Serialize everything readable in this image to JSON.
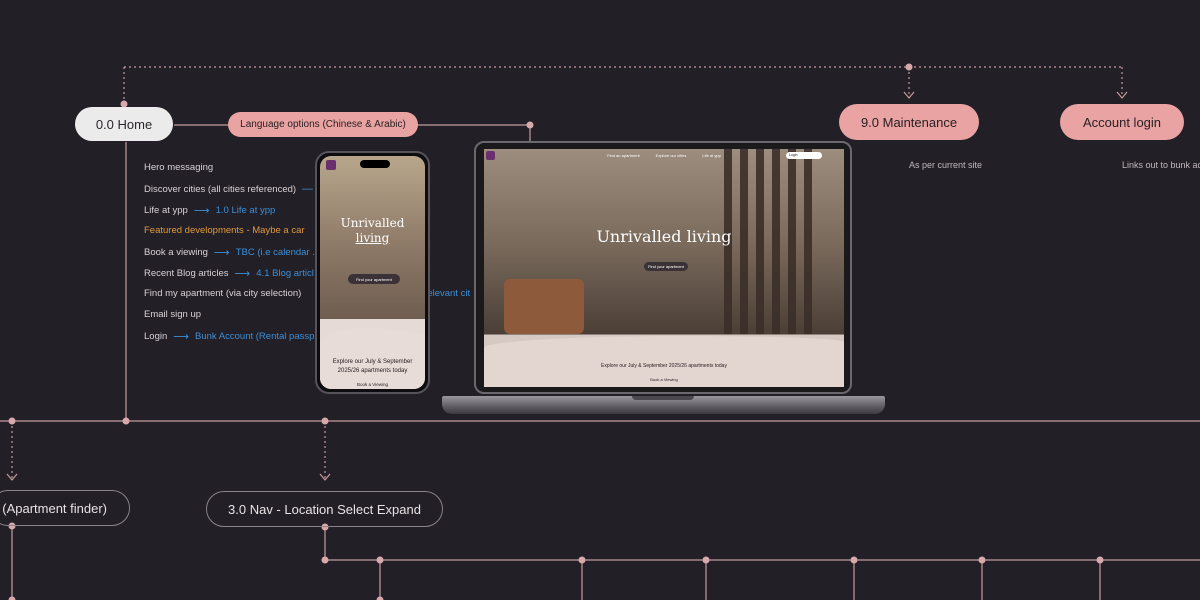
{
  "nodes": {
    "home": "0.0 Home",
    "language": "Language options (Chinese & Arabic)",
    "maintenance": "9.0 Maintenance",
    "account_login": "Account login",
    "apartment_finder": "(Apartment finder)",
    "nav_location": "3.0 Nav - Location Select Expand"
  },
  "notes": {
    "maintenance": "As per current site",
    "account_login": "Links out to bunk ac"
  },
  "home_sections": [
    {
      "label": "Hero messaging",
      "highlight": false,
      "link": ""
    },
    {
      "label": "Discover cities (all cities referenced)",
      "highlight": false,
      "link": ""
    },
    {
      "label": "Life at ypp",
      "highlight": false,
      "link": "1.0 Life at ypp"
    },
    {
      "label": "Featured developments - Maybe a car",
      "highlight": true,
      "link": ""
    },
    {
      "label": "Book a viewing",
      "highlight": false,
      "link": "TBC (i.e calendar ... on)"
    },
    {
      "label": "Recent Blog articles",
      "highlight": false,
      "link": "4.1 Blog articl"
    },
    {
      "label": "Find my apartment (via city selection)",
      "highlight": false,
      "link": "elevant cit"
    },
    {
      "label": "Email sign up",
      "highlight": false,
      "link": ""
    },
    {
      "label": "Login",
      "highlight": false,
      "link": "Bunk Account (Rental passp"
    }
  ],
  "mockups": {
    "hero_title": "Unrivalled living",
    "phone_hero_line1": "Unrivalled",
    "phone_hero_line2": "living",
    "cta": "Find your apartment",
    "explore_text": "Explore our July & September 2025/26 apartments today",
    "book": "Book a Viewing",
    "laptop_nav": [
      "Find an apartment",
      "Explore our cities",
      "Life at ypp"
    ],
    "login": "Login"
  },
  "colors": {
    "background": "#221f26",
    "wire": "#c49c9e",
    "node_pink": "#e8a3a2",
    "node_light": "#ecebec",
    "link_blue": "#3c8fd6",
    "highlight_orange": "#e09a3e"
  }
}
